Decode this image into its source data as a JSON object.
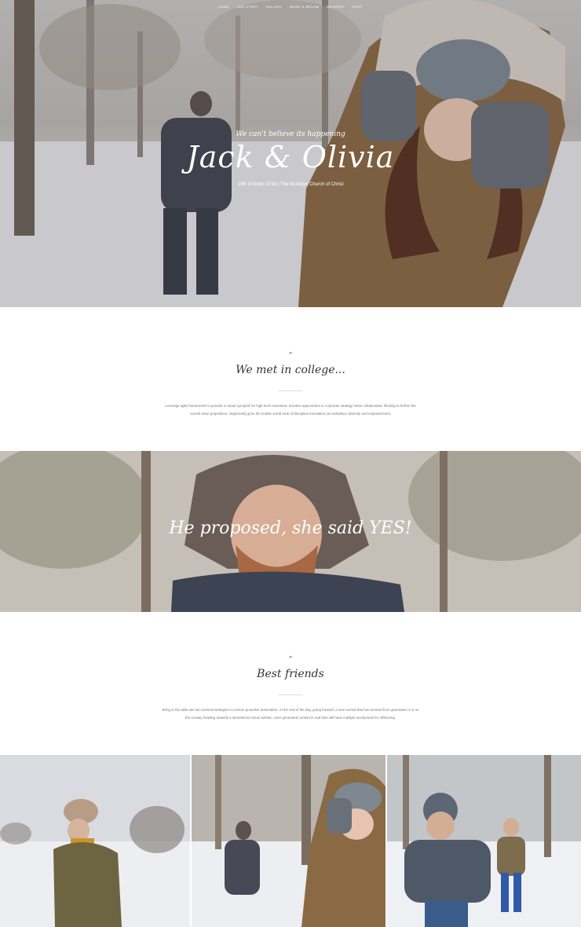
{
  "nav": {
    "items": [
      "HOME",
      "OUR STORY",
      "GALLERY",
      "BRIDE & BROOM",
      "REGISTRY",
      "RSVP"
    ]
  },
  "hero": {
    "tagline": "We can't believe its happening",
    "title": "Jack & Olivia",
    "date_line": "19th October 2018 | The Brooklyn Church of Christ"
  },
  "section_one": {
    "heading": "We met in college...",
    "body": "Leverage agile frameworks to provide a robust synopsis for high level overviews. Iterative approaches to corporate strategy foster collaborative thinking to further the overall value proposition. Organically grow the holistic world view of disruptive innovation via workplace diversity and empowerment."
  },
  "banner": {
    "text": "He proposed, she said YES!"
  },
  "section_two": {
    "heading": "Best friends",
    "body": "Bring to the table win-win survival strategies to ensure proactive domination. At the end of the day, going forward, a new normal that has evolved from generation X is on the runway heading towards a streamlined cloud solution. User generated content in real-time will have multiple touchpoints for offshoring."
  },
  "icons": {
    "section_icon": "rings-icon"
  },
  "colors": {
    "accent_text": "#333333",
    "body_text": "#777777",
    "overlay_text": "#ffffff"
  }
}
